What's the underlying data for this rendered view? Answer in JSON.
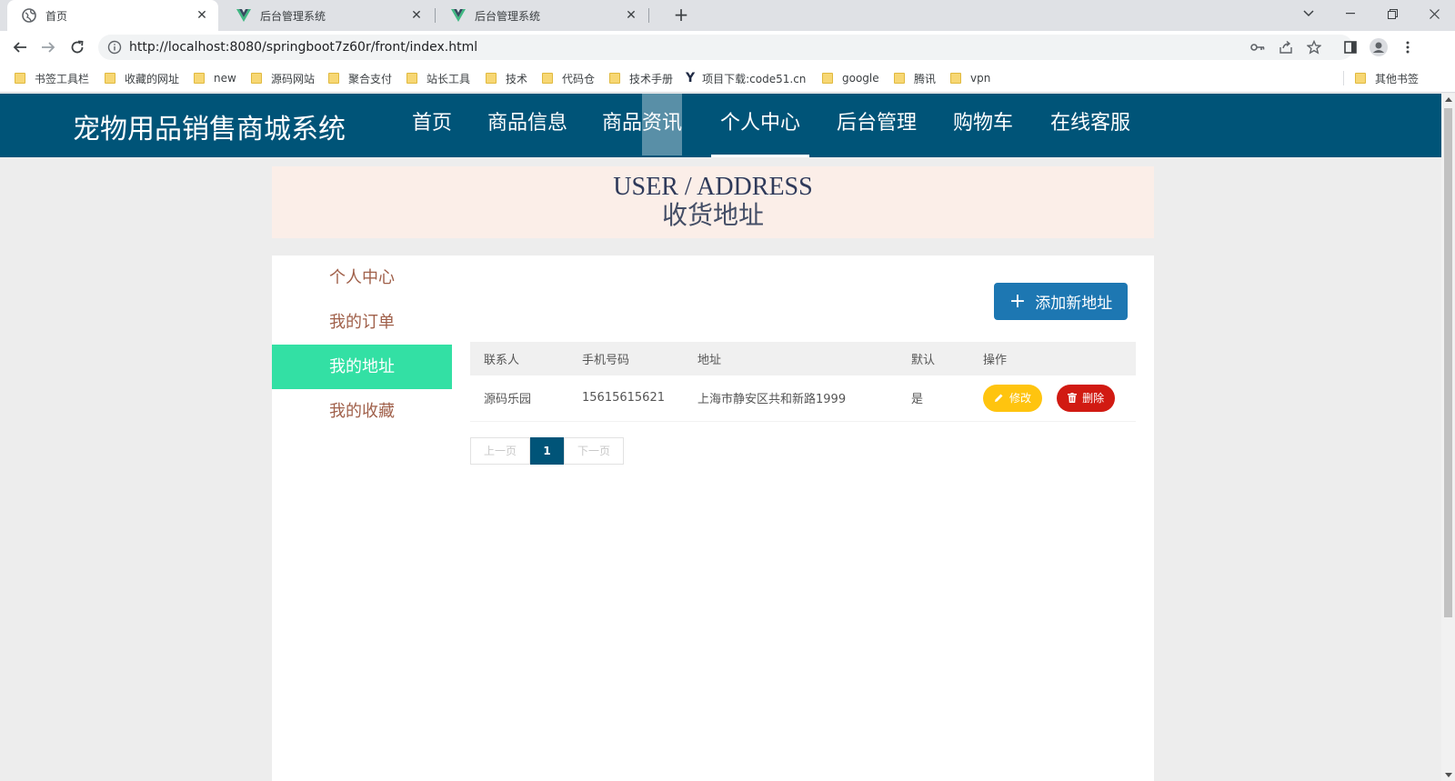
{
  "browser": {
    "tabs": [
      {
        "title": "首页",
        "active": true,
        "icon": "globe-icon"
      },
      {
        "title": "后台管理系统",
        "active": false,
        "icon": "vue-icon"
      },
      {
        "title": "后台管理系统",
        "active": false,
        "icon": "vue-icon"
      }
    ],
    "url": "http://localhost:8080/springboot7z60r/front/index.html",
    "bookmarks": [
      "书签工具栏",
      "收藏的网址",
      "new",
      "源码网站",
      "聚合支付",
      "站长工具",
      "技术",
      "代码仓",
      "技术手册",
      "项目下载:code51.cn",
      "google",
      "腾讯",
      "vpn"
    ],
    "other_bookmarks": "其他书签"
  },
  "site": {
    "brand": "宠物用品销售商城系统",
    "nav": [
      "首页",
      "商品信息",
      "商品资讯",
      "个人中心",
      "后台管理",
      "购物车",
      "在线客服"
    ],
    "nav_current": "个人中心",
    "nav_hover": "商品资讯",
    "colors": {
      "nav_bg": "#005478",
      "side_active": "#33e0a4",
      "add_button": "#1d77b2",
      "edit": "#ffc40f",
      "delete": "#d11a12"
    }
  },
  "banner": {
    "en": "USER / ADDRESS",
    "zh": "收货地址"
  },
  "sidemenu": {
    "items": [
      "个人中心",
      "我的订单",
      "我的地址",
      "我的收藏"
    ],
    "active": "我的地址"
  },
  "actions": {
    "add_label": "添加新地址"
  },
  "table": {
    "headers": [
      "联系人",
      "手机号码",
      "地址",
      "默认",
      "操作"
    ],
    "rows": [
      {
        "contact": "源码乐园",
        "phone": "15615615621",
        "address": "上海市静安区共和新路1999",
        "default": "是",
        "edit": "修改",
        "delete": "删除"
      }
    ]
  },
  "pager": {
    "prev": "上一页",
    "current": "1",
    "next": "下一页"
  }
}
